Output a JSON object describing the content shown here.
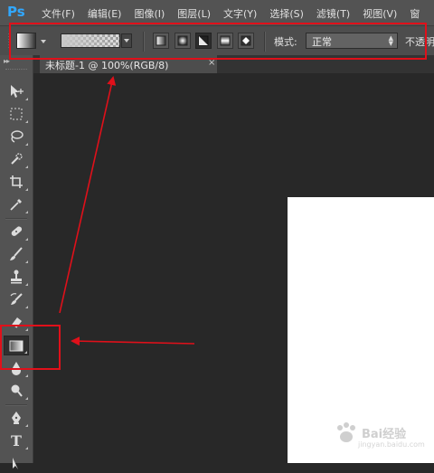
{
  "app": {
    "logo": "Ps"
  },
  "menu": {
    "items": [
      "文件(F)",
      "编辑(E)",
      "图像(I)",
      "图层(L)",
      "文字(Y)",
      "选择(S)",
      "滤镜(T)",
      "视图(V)",
      "窗"
    ]
  },
  "options_bar": {
    "mode_label": "模式:",
    "mode_value": "正常",
    "opacity_label": "不透明",
    "gradient_types": [
      "linear",
      "radial",
      "angle",
      "reflected",
      "diamond"
    ],
    "active_gradient_type": "angle"
  },
  "document": {
    "tab_title": "未标题-1 @ 100%(RGB/8)",
    "tab_close": "×"
  },
  "toolbox": {
    "collapse_glyph": "▸▸",
    "selected_tool": "gradient-tool"
  },
  "annotations": {
    "color": "#e0101a"
  },
  "watermark": {
    "text": "Bai经验",
    "url": "jingyan.baidu.com"
  }
}
